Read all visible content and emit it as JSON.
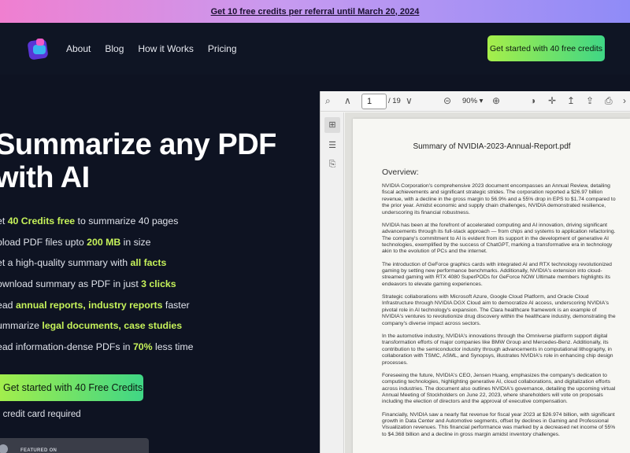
{
  "promo": {
    "text": "Get 10 free credits per referral until March 20, 2024"
  },
  "nav": {
    "links": [
      "About",
      "Blog",
      "How it Works",
      "Pricing"
    ],
    "cta": "Get started with 40 free credits"
  },
  "hero": {
    "title_line1": "Summarize any PDF",
    "title_line2": "with AI",
    "features": [
      {
        "pre": "et ",
        "hl": "40 Credits free",
        "post": " to summarize 40 pages"
      },
      {
        "pre": "pload PDF files upto ",
        "hl": "200 MB",
        "post": " in size"
      },
      {
        "pre": "et a high-quality summary with ",
        "hl": "all facts",
        "post": ""
      },
      {
        "pre": "ownload summary as PDF in just ",
        "hl": "3 clicks",
        "post": ""
      },
      {
        "pre": "ead ",
        "hl": "annual reports, industry reports",
        "post": " faster"
      },
      {
        "pre": "ummarize ",
        "hl": "legal documents, case studies",
        "post": ""
      },
      {
        "pre": "ead information-dense PDFs in ",
        "hl": "70%",
        "post": " less time"
      }
    ],
    "cta": "Get started with 40 Free Credits",
    "note": "o credit card required",
    "featured_label": "FEATURED ON"
  },
  "viewer": {
    "page_value": "1",
    "page_total": "/ 19",
    "zoom": "90%",
    "doc_title": "Summary of NVIDIA-2023-Annual-Report.pdf",
    "heading": "Overview:",
    "paragraphs": [
      "NVIDIA Corporation's comprehensive 2023 document encompasses an Annual Review, detailing fiscal achievements and significant strategic strides. The corporation reported a $26.97 billion revenue, with a decline in the gross margin to 56.9% and a 55% drop in EPS to $1.74 compared to the prior year. Amidst economic and supply chain challenges, NVIDIA demonstrated resilience, underscoring its financial robustness.",
      "NVIDIA has been at the forefront of accelerated computing and AI innovation, driving significant advancements through its full-stack approach — from chips and systems to application refactoring. The company's commitment to AI is evident from its support in the development of generative AI technologies, exemplified by the success of ChatGPT, marking a transformative era in technology akin to the evolution of PCs and the internet.",
      "The introduction of GeForce graphics cards with integrated AI and RTX technology revolutionized gaming by setting new performance benchmarks. Additionally, NVIDIA's extension into cloud-streamed gaming with RTX 4080 SuperPODs for GeForce NOW Ultimate members highlights its endeavors to elevate gaming experiences.",
      "Strategic collaborations with Microsoft Azure, Google Cloud Platform, and Oracle Cloud Infrastructure through NVIDIA DGX Cloud aim to democratize AI access, underscoring NVIDIA's pivotal role in AI technology's expansion. The Clara healthcare framework is an example of NVIDIA's ventures to revolutionize drug discovery within the healthcare industry, demonstrating the company's diverse impact across sectors.",
      "In the automotive industry, NVIDIA's innovations through the Omniverse platform support digital transformation efforts of major companies like BMW Group and Mercedes-Benz. Additionally, its contribution to the semiconductor industry through advancements in computational lithography, in collaboration with TSMC, ASML, and Synopsys, illustrates NVIDIA's role in enhancing chip design processes.",
      "Foreseeing the future, NVIDIA's CEO, Jensen Huang, emphasizes the company's dedication to computing technologies, highlighting generative AI, cloud collaborations, and digitalization efforts across industries. The document also outlines NVIDIA's governance, detailing the upcoming virtual Annual Meeting of Stockholders on June 22, 2023, where shareholders will vote on proposals including the election of directors and the approval of executive compensation.",
      "Financially, NVIDIA saw a nearly flat revenue for fiscal year 2023 at $26.974 billion, with significant growth in Data Center and Automotive segments, offset by declines in Gaming and Professional Visualization revenues. This financial performance was marked by a decreased net income of 55% to $4.368 billion and a decline in gross margin amidst inventory challenges."
    ]
  },
  "icons": {
    "search": "search-icon",
    "up": "chevron-up-icon",
    "down": "chevron-down-icon",
    "zoom_out": "zoom-out-icon",
    "zoom_in": "zoom-in-icon",
    "theme": "contrast-icon",
    "move": "move-icon",
    "upload": "upload-icon",
    "share": "share-icon",
    "print": "print-icon",
    "thumbnails": "thumbnails-icon",
    "outline": "outline-icon",
    "attach": "paperclip-icon"
  },
  "colors": {
    "accent_start": "#a6ef4a",
    "accent_end": "#3fd685",
    "highlight": "#c6f25a",
    "background": "#0e1322"
  }
}
